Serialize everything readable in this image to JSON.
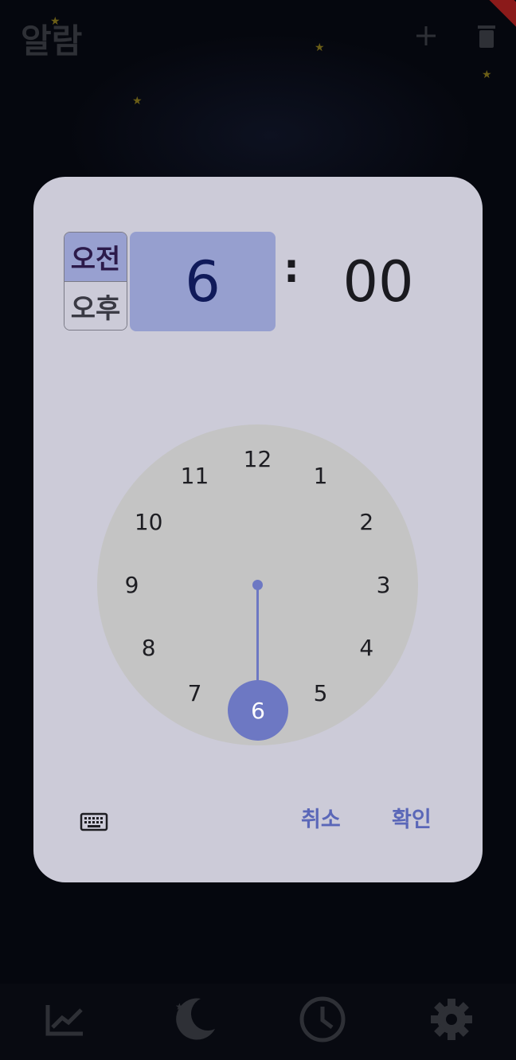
{
  "app": {
    "title": "알람"
  },
  "debug_banner": "G",
  "icons": {
    "add": "plus-icon",
    "delete": "trash-icon",
    "stats": "chart-icon",
    "sleep": "moon-icon",
    "clock": "clock-icon",
    "settings": "gear-icon",
    "keyboard": "keyboard-icon"
  },
  "dialog": {
    "am_label": "오전",
    "pm_label": "오후",
    "selected_period": "오전",
    "hour": "6",
    "separator": ":",
    "minute": "00",
    "dial_numbers": [
      "12",
      "1",
      "2",
      "3",
      "4",
      "5",
      "6",
      "7",
      "8",
      "9",
      "10",
      "11"
    ],
    "selected_hour": "6",
    "cancel_label": "취소",
    "confirm_label": "확인"
  },
  "colors": {
    "accent": "#6d78c3",
    "dialog_bg": "#cccbd8",
    "hour_box": "#969fcf",
    "dial_face": "#c4c4c4"
  }
}
